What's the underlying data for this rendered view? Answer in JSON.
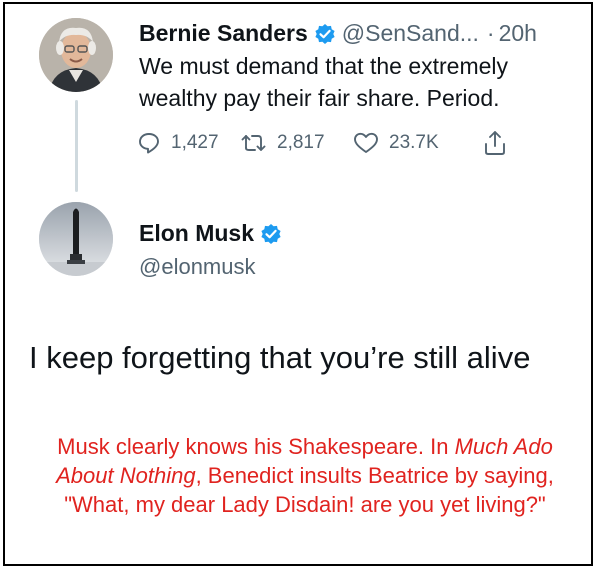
{
  "tweet": {
    "author_name": "Bernie Sanders",
    "author_handle": "@SenSand...",
    "separator": "·",
    "time": "20h",
    "text": "We must demand that the extremely wealthy pay their fair share. Period.",
    "stats": {
      "replies": "1,427",
      "retweets": "2,817",
      "likes": "23.7K"
    },
    "icons": [
      "reply-icon",
      "retweet-icon",
      "like-icon",
      "share-icon",
      "verified-badge-icon"
    ]
  },
  "reply": {
    "author_name": "Elon Musk",
    "author_handle": "@elonmusk",
    "text": "I keep forgetting that you’re still alive"
  },
  "caption": {
    "part1": "Musk clearly knows his Shakespeare. In ",
    "italic": "Much Ado About Nothing",
    "part2": ", Benedict insults Beatrice by saying, \"What, my dear Lady Disdain! are you yet living?\""
  },
  "colors": {
    "verified_blue": "#1d9bf0",
    "text": "#0f1419",
    "muted": "#536471",
    "caption_red": "#e0231f",
    "thread_line": "#cfd9de"
  }
}
